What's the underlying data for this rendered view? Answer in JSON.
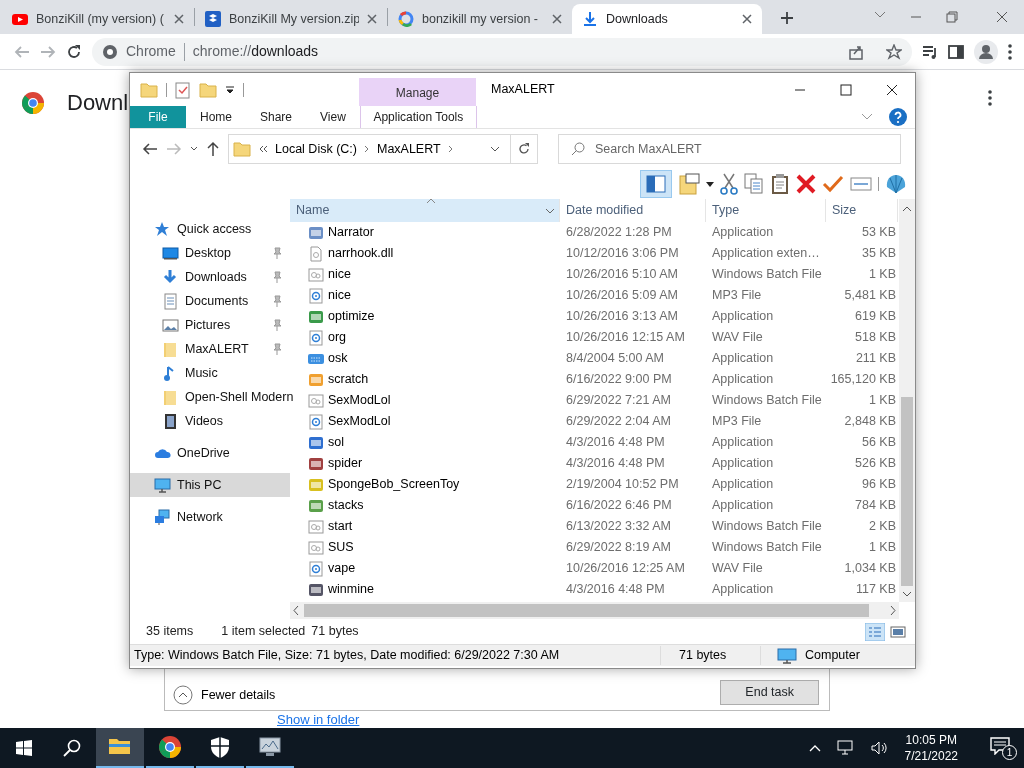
{
  "browser": {
    "tabs": [
      {
        "title": "BonziKill (my version) (",
        "kind": "video",
        "selected": false
      },
      {
        "title": "BonziKill My version.zip",
        "kind": "box",
        "selected": false
      },
      {
        "title": "bonzikill my version -",
        "kind": "search",
        "selected": false
      },
      {
        "title": "Downloads",
        "kind": "download",
        "selected": true
      }
    ],
    "site_label": "Chrome",
    "url_scheme": "chrome://",
    "url_path": "downloads"
  },
  "page": {
    "heading": "Downl",
    "link": "Show in folder"
  },
  "task_manager": {
    "fewer_details": "Fewer details",
    "end_task": "End task"
  },
  "explorer": {
    "title": "MaxALERT",
    "context_group": "Manage",
    "ribbon_tabs": [
      {
        "label": "File",
        "kind": "file"
      },
      {
        "label": "Home",
        "kind": "tab"
      },
      {
        "label": "Share",
        "kind": "tab"
      },
      {
        "label": "View",
        "kind": "tab"
      },
      {
        "label": "Application Tools",
        "kind": "context"
      }
    ],
    "breadcrumb": [
      "Local Disk (C:)",
      "MaxALERT"
    ],
    "search": {
      "placeholder": "Search MaxALERT"
    },
    "nav": [
      {
        "label": "Quick access",
        "kind": "star",
        "selected": false,
        "children": [
          {
            "label": "Desktop",
            "kind": "desktop",
            "pinned": true,
            "selected": false
          },
          {
            "label": "Downloads",
            "kind": "download",
            "pinned": true,
            "selected": false
          },
          {
            "label": "Documents",
            "kind": "document",
            "pinned": true,
            "selected": false
          },
          {
            "label": "Pictures",
            "kind": "picture",
            "pinned": true,
            "selected": false
          },
          {
            "label": "MaxALERT",
            "kind": "folder",
            "pinned": true,
            "selected": false
          },
          {
            "label": "Music",
            "kind": "music",
            "pinned": false,
            "selected": false
          },
          {
            "label": "Open-Shell Modern",
            "kind": "folder",
            "pinned": false,
            "selected": false
          },
          {
            "label": "Videos",
            "kind": "video",
            "pinned": false,
            "selected": false
          }
        ]
      },
      {
        "label": "OneDrive",
        "kind": "cloud",
        "selected": false
      },
      {
        "label": "This PC",
        "kind": "pc",
        "selected": true
      },
      {
        "label": "Network",
        "kind": "network",
        "selected": false
      }
    ],
    "columns": [
      {
        "label": "Name",
        "sorted": true
      },
      {
        "label": "Date modified",
        "sorted": false
      },
      {
        "label": "Type",
        "sorted": false
      },
      {
        "label": "Size",
        "sorted": false
      }
    ],
    "files": [
      {
        "name": "Narrator",
        "date": "6/28/2022 1:28 PM",
        "type": "Application",
        "size": "53 KB",
        "kind": "app"
      },
      {
        "name": "narrhook.dll",
        "date": "10/12/2016 3:06 PM",
        "type": "Application exten…",
        "size": "35 KB",
        "kind": "dll"
      },
      {
        "name": "nice",
        "date": "10/26/2016 5:10 AM",
        "type": "Windows Batch File",
        "size": "1 KB",
        "kind": "batch"
      },
      {
        "name": "nice",
        "date": "10/26/2016 5:09 AM",
        "type": "MP3 File",
        "size": "5,481 KB",
        "kind": "audio"
      },
      {
        "name": "optimize",
        "date": "10/26/2016 3:13 AM",
        "type": "Application",
        "size": "619 KB",
        "kind": "app"
      },
      {
        "name": "org",
        "date": "10/26/2016 12:15 AM",
        "type": "WAV File",
        "size": "518 KB",
        "kind": "audio"
      },
      {
        "name": "osk",
        "date": "8/4/2004 5:00 AM",
        "type": "Application",
        "size": "211 KB",
        "kind": "keyboard"
      },
      {
        "name": "scratch",
        "date": "6/16/2022 9:00 PM",
        "type": "Application",
        "size": "165,120 KB",
        "kind": "app"
      },
      {
        "name": "SexModLol",
        "date": "6/29/2022 7:21 AM",
        "type": "Windows Batch File",
        "size": "1 KB",
        "kind": "batch"
      },
      {
        "name": "SexModLol",
        "date": "6/29/2022 2:04 AM",
        "type": "MP3 File",
        "size": "2,848 KB",
        "kind": "audio"
      },
      {
        "name": "sol",
        "date": "4/3/2016 4:48 PM",
        "type": "Application",
        "size": "56 KB",
        "kind": "app"
      },
      {
        "name": "spider",
        "date": "4/3/2016 4:48 PM",
        "type": "Application",
        "size": "526 KB",
        "kind": "app"
      },
      {
        "name": "SpongeBob_ScreenToy",
        "date": "2/19/2004 10:52 PM",
        "type": "Application",
        "size": "96 KB",
        "kind": "app"
      },
      {
        "name": "stacks",
        "date": "6/16/2022 6:46 PM",
        "type": "Application",
        "size": "784 KB",
        "kind": "app"
      },
      {
        "name": "start",
        "date": "6/13/2022 3:32 AM",
        "type": "Windows Batch File",
        "size": "2 KB",
        "kind": "batch"
      },
      {
        "name": "SUS",
        "date": "6/29/2022 8:19 AM",
        "type": "Windows Batch File",
        "size": "1 KB",
        "kind": "batch"
      },
      {
        "name": "vape",
        "date": "10/26/2016 12:25 AM",
        "type": "WAV File",
        "size": "1,034 KB",
        "kind": "audio"
      },
      {
        "name": "winmine",
        "date": "4/3/2016 4:48 PM",
        "type": "Application",
        "size": "117 KB",
        "kind": "app"
      }
    ],
    "status": {
      "count": "35 items",
      "selection": "1 item selected",
      "selection_size": "71 bytes"
    },
    "details": {
      "info": "Type: Windows Batch File, Size: 71 bytes, Date modified: 6/29/2022 7:30 AM",
      "size": "71 bytes",
      "zone": "Computer"
    }
  },
  "taskbar": {
    "apps": [
      {
        "kind": "folder",
        "selected": true
      },
      {
        "kind": "browser",
        "selected": false
      },
      {
        "kind": "shield",
        "selected": false
      },
      {
        "kind": "monitor",
        "selected": false
      }
    ],
    "time": "10:05 PM",
    "date": "7/21/2022",
    "notification_count": "1"
  }
}
